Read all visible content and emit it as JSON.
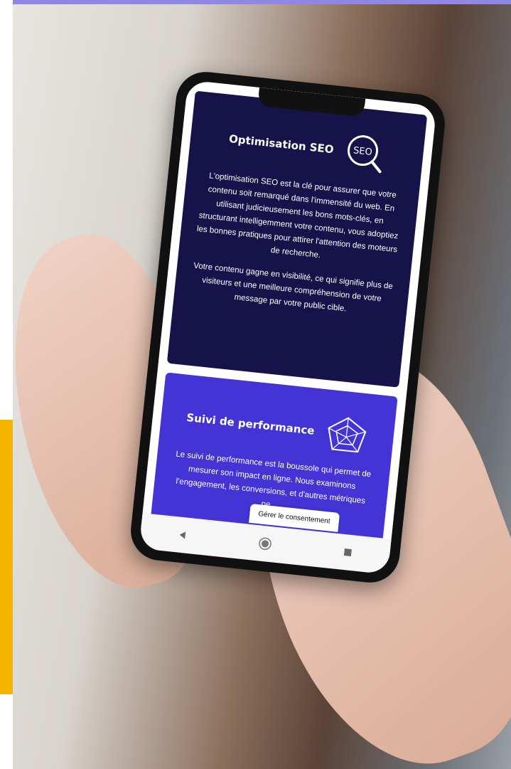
{
  "card1": {
    "title": "Optimisation SEO",
    "icon_label": "SEO",
    "paragraph1": "L'optimisation SEO est la clé pour assurer que votre contenu soit remarqué dans l'immensité du web. En utilisant judicieusement les bons mots-clés, en structurant intelligemment votre contenu, vous adoptiez les bonnes pratiques pour attirer l'attention des moteurs de recherche.",
    "paragraph2": "Votre contenu gagne en visibilité, ce qui signifie plus de visiteurs et une meilleure compréhension de votre message par votre public cible."
  },
  "card2": {
    "title": "Suivi de performance",
    "paragraph": "Le suivi de performance est la boussole qui permet de mesurer son impact en ligne. Nous examinons l'engagement, les conversions, et d'autres métriques pe..."
  },
  "consent_button": "Gérer le consentement",
  "nav": {
    "back_icon": "back-triangle-icon",
    "home_icon": "home-circle-icon",
    "recent_icon": "recent-square-icon"
  },
  "colors": {
    "card1_bg": "#16134a",
    "card2_bg": "#4434d6",
    "accent_bar": "#8f86e8",
    "yellow": "#f3b500"
  }
}
